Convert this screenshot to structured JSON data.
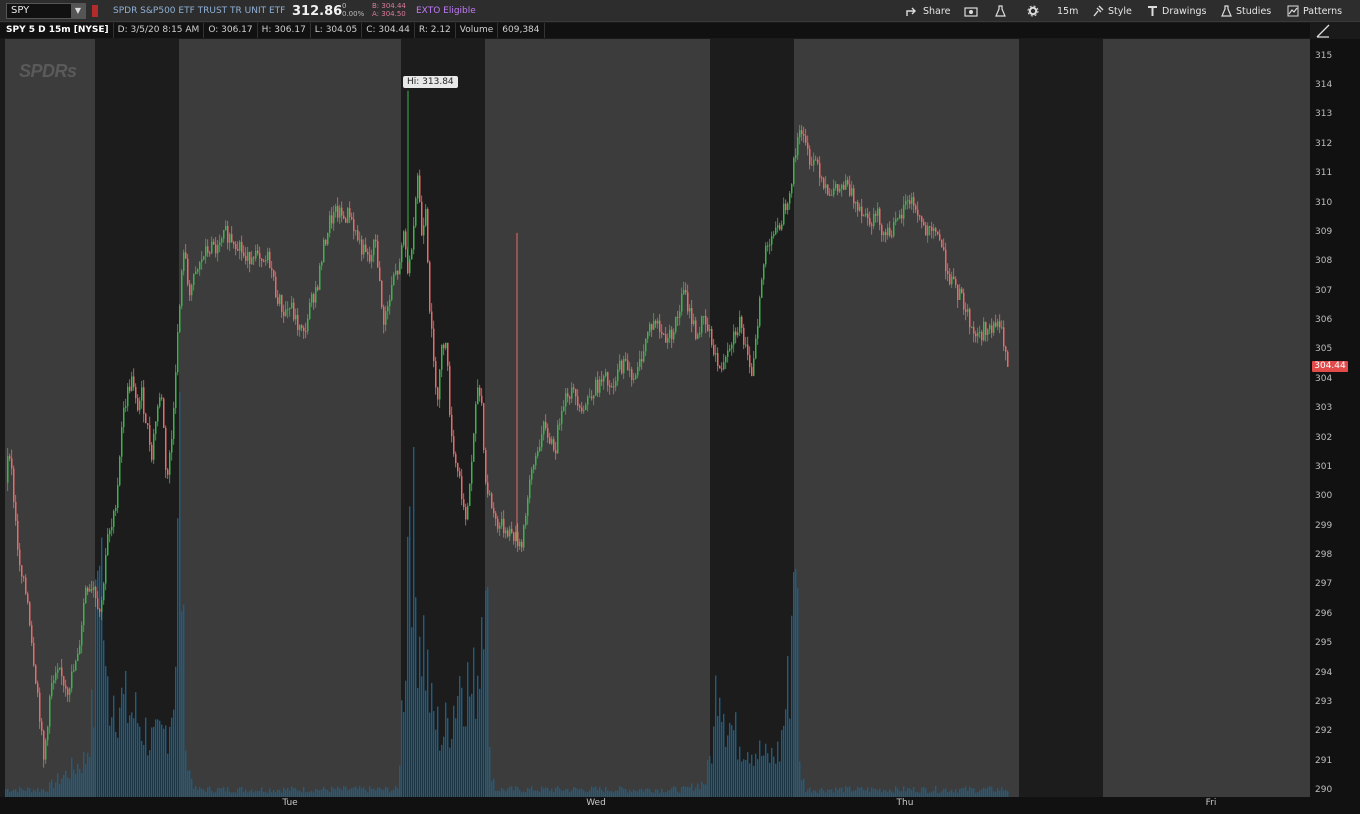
{
  "header": {
    "symbol": "SPY",
    "description": "SPDR S&P500 ETF TRUST TR UNIT ETF",
    "last": "312.86",
    "change": "0",
    "change_pct": "0.00%",
    "bid": "B: 304.44",
    "ask": "A: 304.50",
    "exto": "EXTO Eligible",
    "tools": {
      "share": "Share",
      "timeframe": "15m",
      "style": "Style",
      "drawings": "Drawings",
      "studies": "Studies",
      "patterns": "Patterns"
    }
  },
  "info": {
    "title": "SPY 5 D 15m [NYSE]",
    "date": "D: 3/5/20 8:15 AM",
    "open": "O: 306.17",
    "high": "H: 306.17",
    "low": "L: 304.05",
    "close": "C: 304.44",
    "range": "R: 2.12",
    "volume_label": "Volume",
    "volume": "609,384"
  },
  "logo_text": "SPDRs",
  "hi_label": "Hi: 313.84",
  "current_price_label": "304.44",
  "colors": {
    "up": "#3cb54a",
    "down": "#ec6a6a",
    "volume": "#1e5e86",
    "regular_session": "#3c3c3c",
    "extended_session": "#1c1c1c"
  },
  "chart_data": {
    "type": "candlestick",
    "y_ticks": [
      "315",
      "314",
      "313",
      "312",
      "311",
      "310",
      "309",
      "308",
      "307",
      "306",
      "305",
      "304",
      "303",
      "302",
      "301",
      "300",
      "299",
      "298",
      "297",
      "296",
      "295",
      "294",
      "293",
      "292",
      "291",
      "290"
    ],
    "ylim": [
      289.8,
      315.6
    ],
    "x_labels": [
      "Tue",
      "Wed",
      "Thu",
      "Fri"
    ],
    "current_price": 304.44,
    "session_high": 313.84,
    "price_path": [
      [
        0,
        300.5
      ],
      [
        3,
        302.0
      ],
      [
        8,
        300.0
      ],
      [
        14,
        297.5
      ],
      [
        22,
        296.5
      ],
      [
        28,
        294.5
      ],
      [
        33,
        293.0
      ],
      [
        38,
        291.0
      ],
      [
        45,
        293.5
      ],
      [
        53,
        294.0
      ],
      [
        62,
        293.5
      ],
      [
        72,
        294.5
      ],
      [
        80,
        297.0
      ],
      [
        88,
        297.0
      ],
      [
        95,
        296.0
      ],
      [
        101,
        298.5
      ],
      [
        107,
        299.0
      ],
      [
        112,
        300.5
      ],
      [
        116,
        302.5
      ],
      [
        121,
        303.5
      ],
      [
        126,
        304.0
      ],
      [
        131,
        303.0
      ],
      [
        136,
        303.5
      ],
      [
        141,
        302.5
      ],
      [
        146,
        301.5
      ],
      [
        151,
        303.0
      ],
      [
        156,
        303.5
      ],
      [
        161,
        300.5
      ],
      [
        166,
        302.0
      ],
      [
        170,
        304.5
      ],
      [
        174,
        306.5
      ],
      [
        178,
        308.5
      ],
      [
        183,
        307.0
      ],
      [
        190,
        307.5
      ],
      [
        197,
        308.2
      ],
      [
        205,
        308.5
      ],
      [
        213,
        308.4
      ],
      [
        220,
        309.0
      ],
      [
        227,
        308.8
      ],
      [
        234,
        308.6
      ],
      [
        240,
        308.0
      ],
      [
        248,
        308.4
      ],
      [
        256,
        307.8
      ],
      [
        263,
        308.2
      ],
      [
        270,
        307.0
      ],
      [
        278,
        306.3
      ],
      [
        285,
        306.5
      ],
      [
        291,
        305.9
      ],
      [
        298,
        305.5
      ],
      [
        305,
        306.6
      ],
      [
        312,
        307.3
      ],
      [
        318,
        308.5
      ],
      [
        324,
        309.4
      ],
      [
        331,
        309.7
      ],
      [
        338,
        309.5
      ],
      [
        344,
        309.7
      ],
      [
        350,
        309.0
      ],
      [
        357,
        308.4
      ],
      [
        364,
        308.0
      ],
      [
        370,
        308.8
      ],
      [
        377,
        306.0
      ],
      [
        383,
        306.5
      ],
      [
        388,
        307.5
      ],
      [
        394,
        307.8
      ],
      [
        398,
        309.0
      ],
      [
        403,
        307.5
      ],
      [
        408,
        309.5
      ],
      [
        412,
        311.0
      ],
      [
        416,
        309.0
      ],
      [
        420,
        310.0
      ],
      [
        424,
        306.5
      ],
      [
        428,
        304.5
      ],
      [
        432,
        303.5
      ],
      [
        436,
        305.0
      ],
      [
        440,
        305.5
      ],
      [
        444,
        303.0
      ],
      [
        448,
        301.5
      ],
      [
        452,
        301.0
      ],
      [
        456,
        300.2
      ],
      [
        460,
        299.0
      ],
      [
        464,
        300.5
      ],
      [
        468,
        302.0
      ],
      [
        472,
        303.8
      ],
      [
        476,
        303.2
      ],
      [
        480,
        300.5
      ],
      [
        484,
        300.0
      ],
      [
        490,
        299.2
      ],
      [
        496,
        299.0
      ],
      [
        502,
        298.9
      ],
      [
        508,
        298.7
      ],
      [
        512,
        298.5
      ],
      [
        516,
        298.5
      ],
      [
        520,
        299.5
      ],
      [
        526,
        300.8
      ],
      [
        532,
        301.7
      ],
      [
        538,
        302.3
      ],
      [
        544,
        302.0
      ],
      [
        550,
        301.7
      ],
      [
        556,
        303.2
      ],
      [
        562,
        303.6
      ],
      [
        570,
        303.5
      ],
      [
        578,
        303.0
      ],
      [
        585,
        303.6
      ],
      [
        592,
        303.8
      ],
      [
        600,
        304.0
      ],
      [
        607,
        303.5
      ],
      [
        614,
        304.5
      ],
      [
        622,
        304.5
      ],
      [
        630,
        304.0
      ],
      [
        637,
        305.0
      ],
      [
        644,
        305.8
      ],
      [
        650,
        306.0
      ],
      [
        657,
        305.5
      ],
      [
        664,
        305.5
      ],
      [
        671,
        306.0
      ],
      [
        678,
        307.0
      ],
      [
        685,
        306.2
      ],
      [
        691,
        305.5
      ],
      [
        697,
        306.0
      ],
      [
        703,
        305.6
      ],
      [
        709,
        305.0
      ],
      [
        714,
        304.2
      ],
      [
        720,
        305.0
      ],
      [
        727,
        305.5
      ],
      [
        734,
        306.0
      ],
      [
        740,
        305.0
      ],
      [
        745,
        304.0
      ],
      [
        750,
        305.5
      ],
      [
        755,
        307.0
      ],
      [
        760,
        308.5
      ],
      [
        766,
        309.0
      ],
      [
        772,
        309.0
      ],
      [
        778,
        309.8
      ],
      [
        784,
        310.5
      ],
      [
        789,
        311.5
      ],
      [
        794,
        312.7
      ],
      [
        799,
        312.0
      ],
      [
        805,
        311.5
      ],
      [
        811,
        311.5
      ],
      [
        817,
        310.8
      ],
      [
        823,
        310.5
      ],
      [
        829,
        310.4
      ],
      [
        835,
        310.5
      ],
      [
        841,
        310.6
      ],
      [
        847,
        310.2
      ],
      [
        853,
        310.0
      ],
      [
        860,
        309.6
      ],
      [
        866,
        309.5
      ],
      [
        872,
        309.6
      ],
      [
        878,
        309.0
      ],
      [
        884,
        309.1
      ],
      [
        890,
        309.2
      ],
      [
        896,
        309.6
      ],
      [
        902,
        310.2
      ],
      [
        908,
        310.0
      ],
      [
        914,
        309.5
      ],
      [
        920,
        309.0
      ],
      [
        926,
        308.9
      ],
      [
        932,
        309.1
      ],
      [
        938,
        308.2
      ],
      [
        944,
        307.5
      ],
      [
        950,
        307.0
      ],
      [
        956,
        306.8
      ],
      [
        962,
        306.2
      ],
      [
        968,
        305.6
      ],
      [
        974,
        305.5
      ],
      [
        980,
        305.8
      ],
      [
        986,
        305.6
      ],
      [
        992,
        306.0
      ],
      [
        998,
        305.3
      ],
      [
        1002,
        304.44
      ]
    ],
    "volume_profile": [
      [
        0,
        0.01
      ],
      [
        40,
        0.01
      ],
      [
        80,
        0.05
      ],
      [
        88,
        0.12
      ],
      [
        94,
        0.4
      ],
      [
        100,
        0.14
      ],
      [
        108,
        0.14
      ],
      [
        118,
        0.12
      ],
      [
        128,
        0.11
      ],
      [
        138,
        0.09
      ],
      [
        148,
        0.07
      ],
      [
        158,
        0.08
      ],
      [
        166,
        0.12
      ],
      [
        170,
        0.19
      ],
      [
        174,
        0.44
      ],
      [
        178,
        0.18
      ],
      [
        182,
        0.04
      ],
      [
        190,
        0.01
      ],
      [
        260,
        0.01
      ],
      [
        372,
        0.01
      ],
      [
        392,
        0.01
      ],
      [
        400,
        0.21
      ],
      [
        404,
        0.46
      ],
      [
        410,
        0.26
      ],
      [
        418,
        0.21
      ],
      [
        426,
        0.11
      ],
      [
        436,
        0.08
      ],
      [
        446,
        0.11
      ],
      [
        456,
        0.17
      ],
      [
        466,
        0.13
      ],
      [
        474,
        0.19
      ],
      [
        480,
        0.41
      ],
      [
        484,
        0.05
      ],
      [
        490,
        0.01
      ],
      [
        680,
        0.01
      ],
      [
        700,
        0.02
      ],
      [
        708,
        0.08
      ],
      [
        712,
        0.19
      ],
      [
        720,
        0.11
      ],
      [
        730,
        0.08
      ],
      [
        742,
        0.07
      ],
      [
        752,
        0.06
      ],
      [
        762,
        0.05
      ],
      [
        774,
        0.06
      ],
      [
        784,
        0.16
      ],
      [
        790,
        0.4
      ],
      [
        794,
        0.04
      ],
      [
        800,
        0.01
      ],
      [
        1000,
        0.01
      ]
    ],
    "sessions": [
      {
        "type": "regular",
        "from": 0,
        "to": 90
      },
      {
        "type": "extended",
        "from": 90,
        "to": 174
      },
      {
        "type": "regular",
        "from": 174,
        "to": 396
      },
      {
        "type": "extended",
        "from": 396,
        "to": 480
      },
      {
        "type": "regular",
        "from": 480,
        "to": 705
      },
      {
        "type": "extended",
        "from": 705,
        "to": 789
      },
      {
        "type": "regular",
        "from": 789,
        "to": 1014
      },
      {
        "type": "extended",
        "from": 1014,
        "to": 1098
      },
      {
        "type": "regular",
        "from": 1098,
        "to": 1305
      }
    ]
  }
}
